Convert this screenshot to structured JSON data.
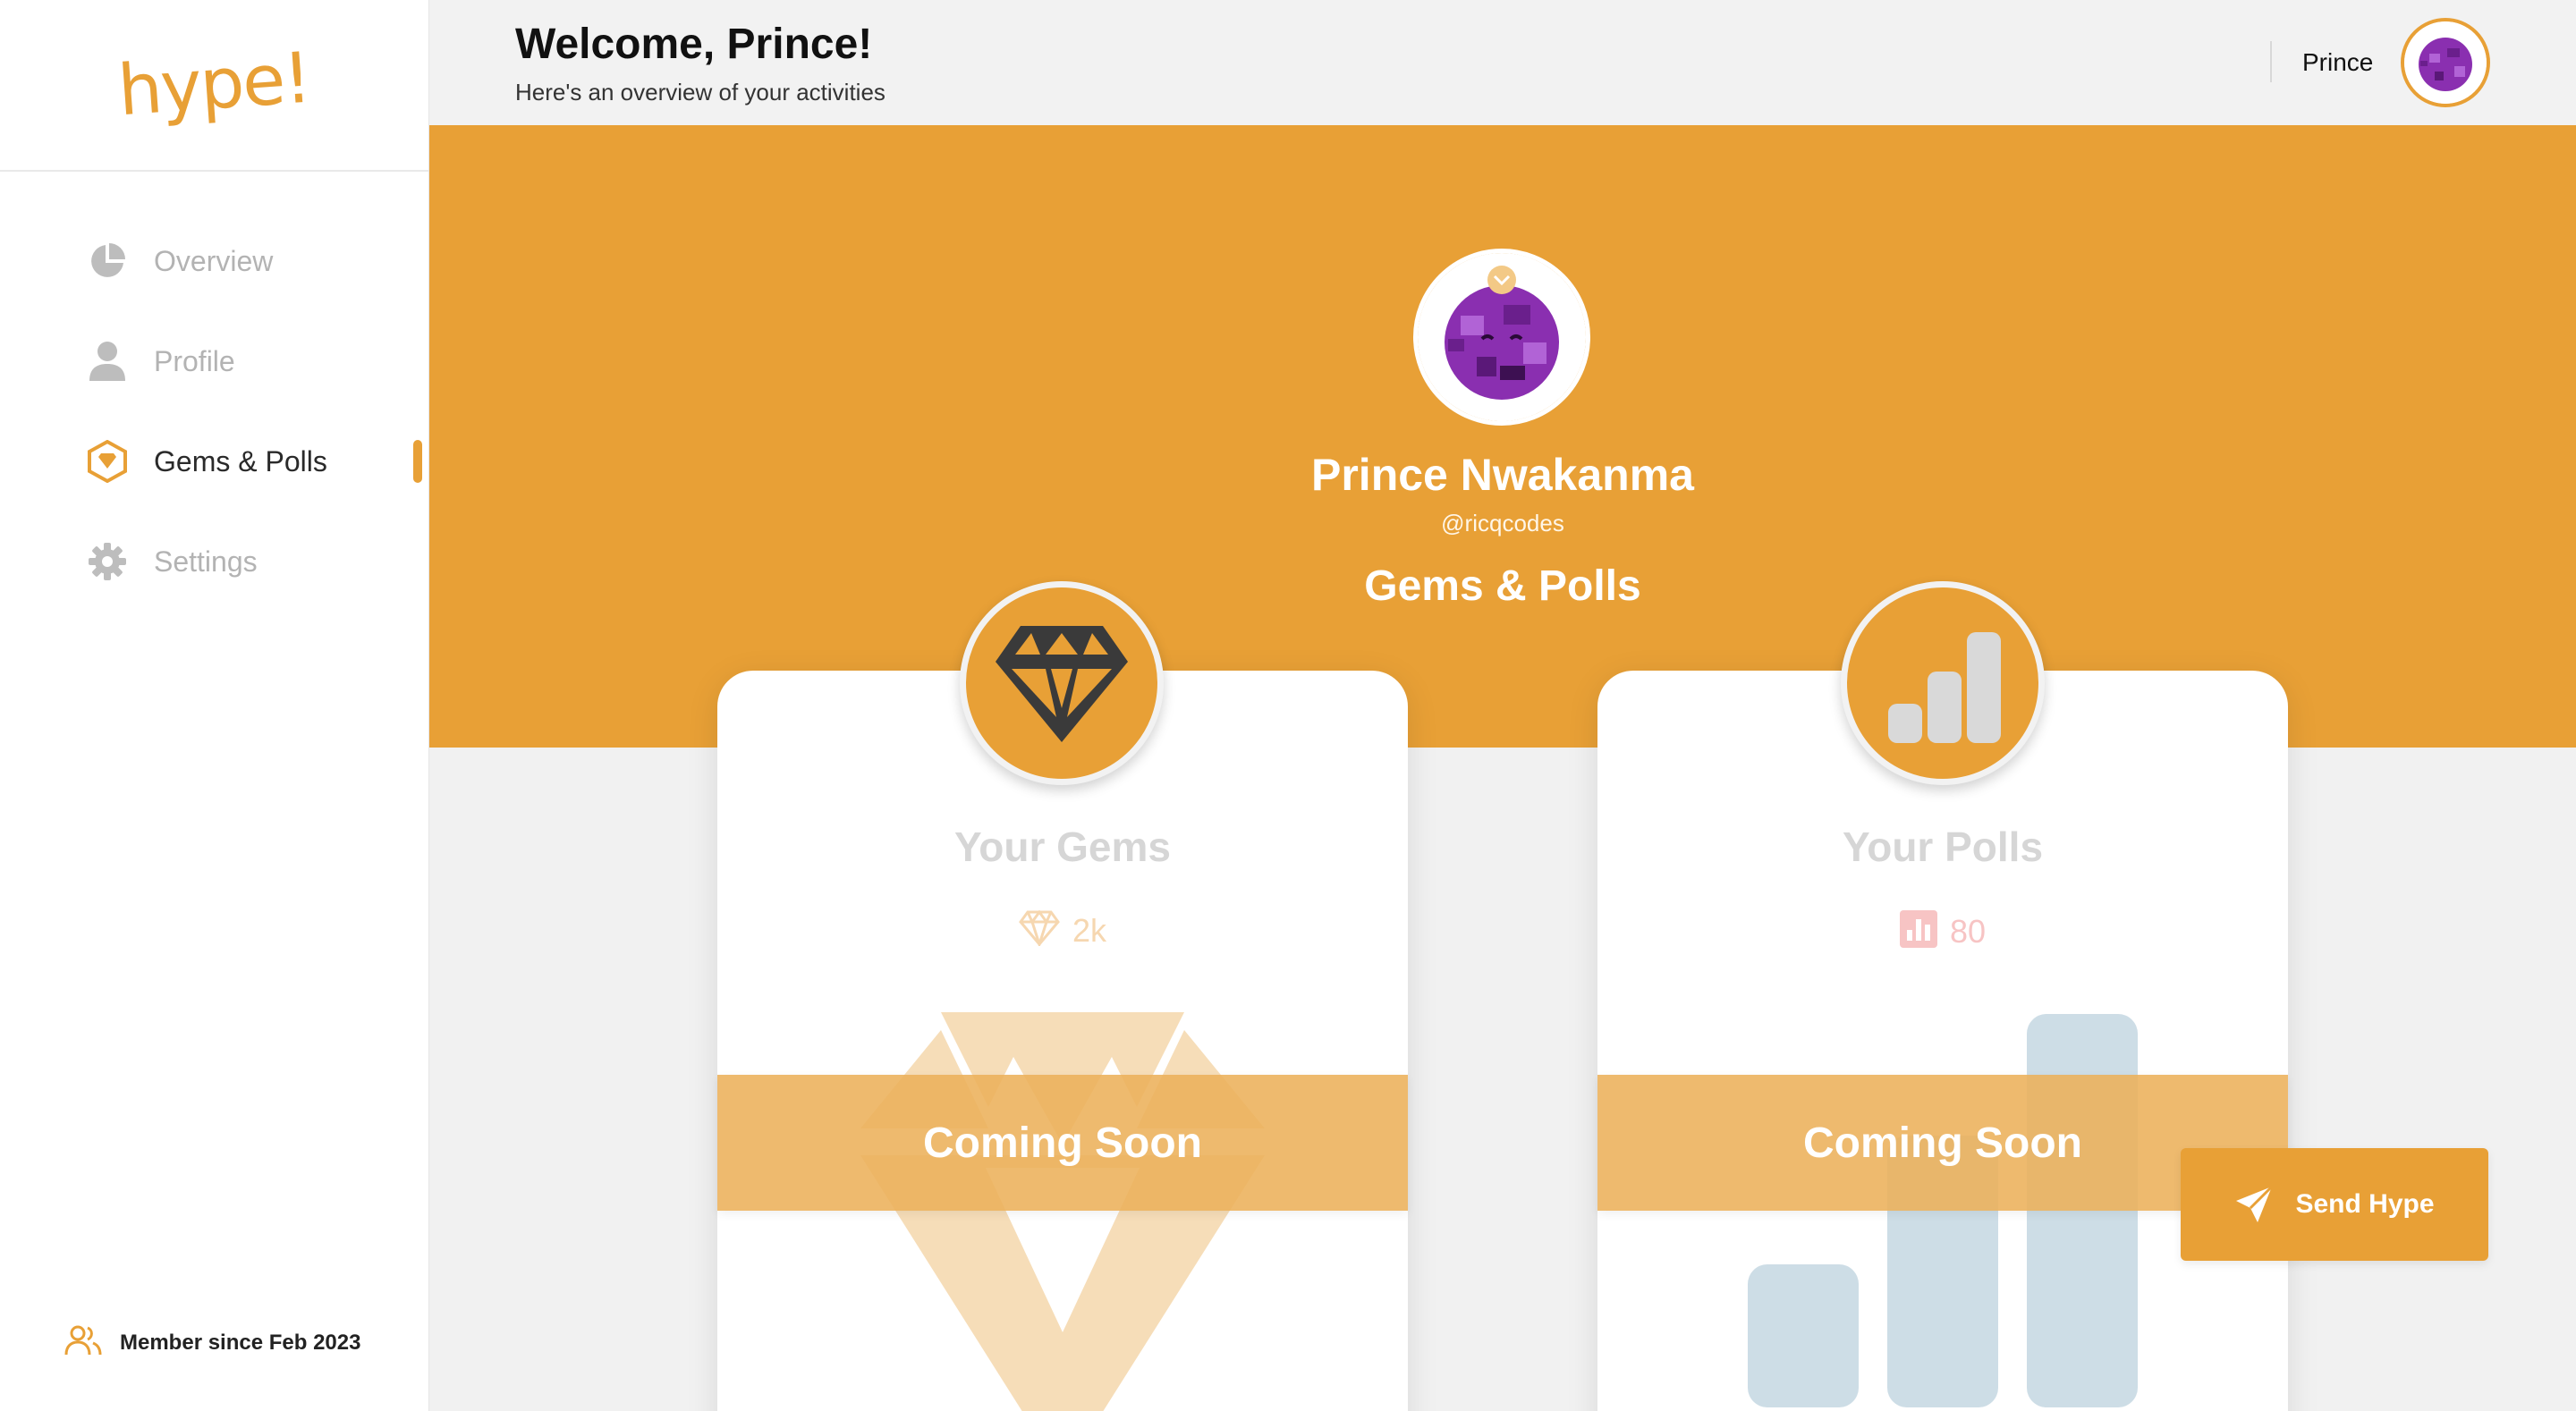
{
  "brand": {
    "logo_text": "hype!",
    "accent": "#e8a036"
  },
  "sidebar": {
    "items": [
      {
        "label": "Overview",
        "icon": "pie-chart-icon",
        "active": false
      },
      {
        "label": "Profile",
        "icon": "user-icon",
        "active": false
      },
      {
        "label": "Gems & Polls",
        "icon": "gem-badge-icon",
        "active": true
      },
      {
        "label": "Settings",
        "icon": "gear-icon",
        "active": false
      }
    ],
    "member_since": "Member since Feb 2023"
  },
  "header": {
    "title": "Welcome, Prince!",
    "subtitle": "Here's an overview of your activities",
    "username": "Prince"
  },
  "profile": {
    "name": "Prince Nwakanma",
    "handle": "@ricqcodes",
    "section_title": "Gems & Polls"
  },
  "cards": {
    "gems": {
      "title": "Your Gems",
      "value": "2k",
      "status": "Coming Soon"
    },
    "polls": {
      "title": "Your Polls",
      "value": "80",
      "status": "Coming Soon"
    }
  },
  "actions": {
    "send_hype": "Send Hype"
  }
}
